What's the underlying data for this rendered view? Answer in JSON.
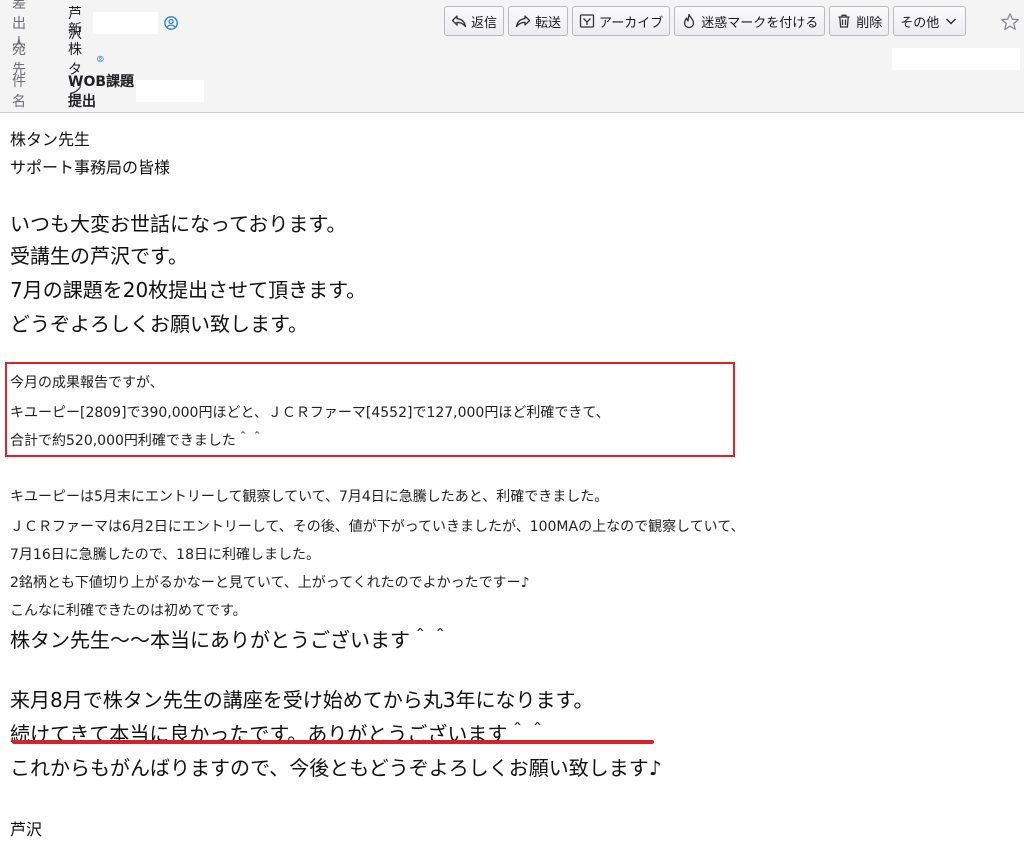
{
  "header": {
    "from_label": "差出人",
    "from_name": "芦沢",
    "to_label": "宛先",
    "to_name": "新株タン",
    "subject_label": "件名",
    "subject": "WOB課題提出"
  },
  "toolbar": {
    "reply": "返信",
    "forward": "転送",
    "archive": "アーカイブ",
    "junk": "迷惑マークを付ける",
    "delete": "削除",
    "more": "その他"
  },
  "body": {
    "greeting1": "株タン先生",
    "greeting2": "サポート事務局の皆様",
    "p1": "いつも大変お世話になっております。",
    "p2": "受講生の芦沢です。",
    "p3": "7月の課題を20枚提出させて頂きます。",
    "p4": "どうぞよろしくお願い致します。",
    "h1": "今月の成果報告ですが、",
    "h2": "キユーピー[2809]で390,000円ほどと、ＪＣＲファーマ[4552]で127,000円ほど利確できて、",
    "h3": "合計で約520,000円利確できました＾＾",
    "d1": "キユーピーは5月末にエントリーして観察していて、7月4日に急騰したあと、利確できました。",
    "d2": "ＪＣＲファーマは6月2日にエントリーして、その後、値が下がっていきましたが、100MAの上なので観察していて、",
    "d3": "7月16日に急騰したので、18日に利確しました。",
    "d4": "2銘柄とも下値切り上がるかなーと見ていて、上がってくれたのでよかったですー♪",
    "d5": "こんなに利確できたのは初めてです。",
    "t1": "株タン先生～～本当にありがとうございます＾＾",
    "t2": "来月8月で株タン先生の講座を受け始めてから丸3年になります。",
    "t3": "続けてきて本当に良かったです。ありがとうございます＾＾",
    "t4": "これからもがんばりますので、今後ともどうぞよろしくお願い致します♪",
    "signature": "芦沢"
  },
  "colors": {
    "header_bg": "#f4f4f5",
    "accent_blue": "#2a7fd4",
    "highlight_red": "#e2202a"
  }
}
